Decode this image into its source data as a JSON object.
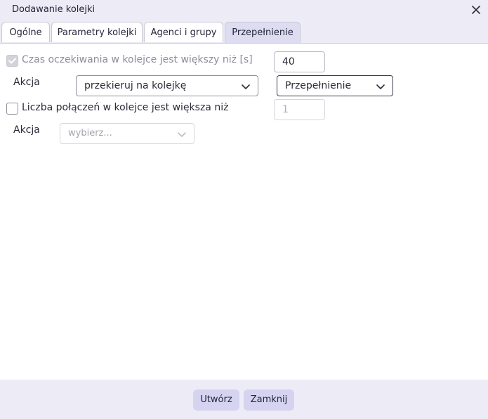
{
  "window": {
    "title": "Dodawanie kolejki"
  },
  "tabs": [
    {
      "label": "Ogólne"
    },
    {
      "label": "Parametry kolejki"
    },
    {
      "label": "Agenci i grupy"
    },
    {
      "label": "Przepełnienie"
    }
  ],
  "overflow": {
    "wait_condition": {
      "label": "Czas oczekiwania w kolejce jest większy niż [s]",
      "checked": true,
      "disabled": true,
      "value": "40",
      "action_label": "Akcja",
      "action_value": "przekieruj na kolejkę",
      "target_value": "Przepełnienie"
    },
    "count_condition": {
      "label": "Liczba połączeń w kolejce jest większa niż",
      "checked": false,
      "placeholder": "1",
      "action_label": "Akcja",
      "action_value": "wybierz..."
    }
  },
  "footer": {
    "create_label": "Utwórz",
    "close_label": "Zamknij"
  },
  "colors": {
    "chrome": "#ecebf6",
    "active_tab": "#dedcf1",
    "button": "#d6d3f0"
  }
}
